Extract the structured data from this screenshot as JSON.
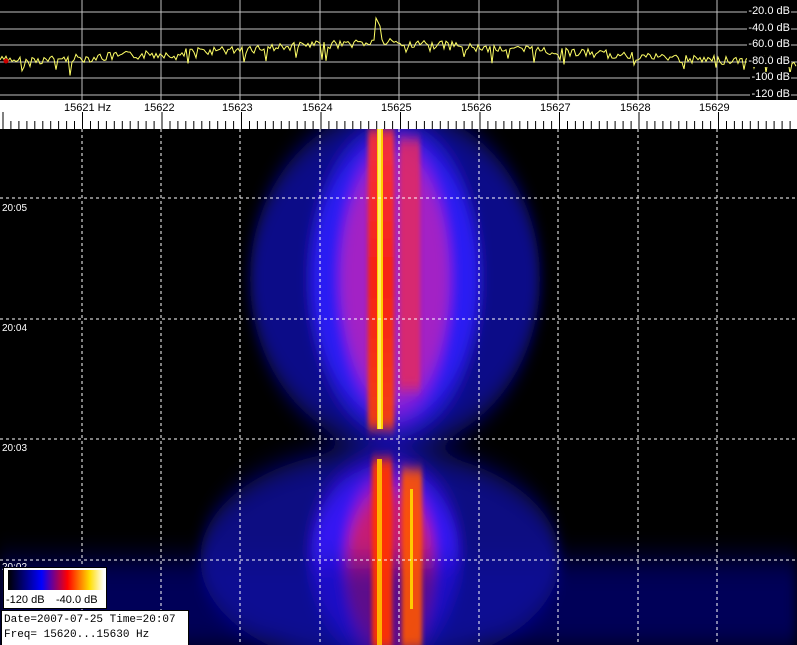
{
  "spectrum": {
    "db_labels": [
      "-20.0 dB",
      "-40.0 dB",
      "-60.0 dB",
      "-80.0 dB",
      "-100 dB",
      "-120 dB"
    ],
    "trace_color": "#ffff66"
  },
  "ruler": {
    "freq_labels": [
      "15621 Hz",
      "15622",
      "15623",
      "15624",
      "15625",
      "15626",
      "15627",
      "15628",
      "15629"
    ]
  },
  "waterfall": {
    "time_labels": [
      "20:05",
      "20:04",
      "20:03",
      "20:02"
    ]
  },
  "legend": {
    "min_label": "-120 dB",
    "max_label": "-40.0 dB",
    "colors": [
      "#000000",
      "#0000ff",
      "#ff0000",
      "#ffdd00",
      "#ffffff"
    ]
  },
  "info": {
    "date_time": "Date=2007-07-25 Time=20:07",
    "freq_range": "Freq= 15620...15630 Hz"
  }
}
